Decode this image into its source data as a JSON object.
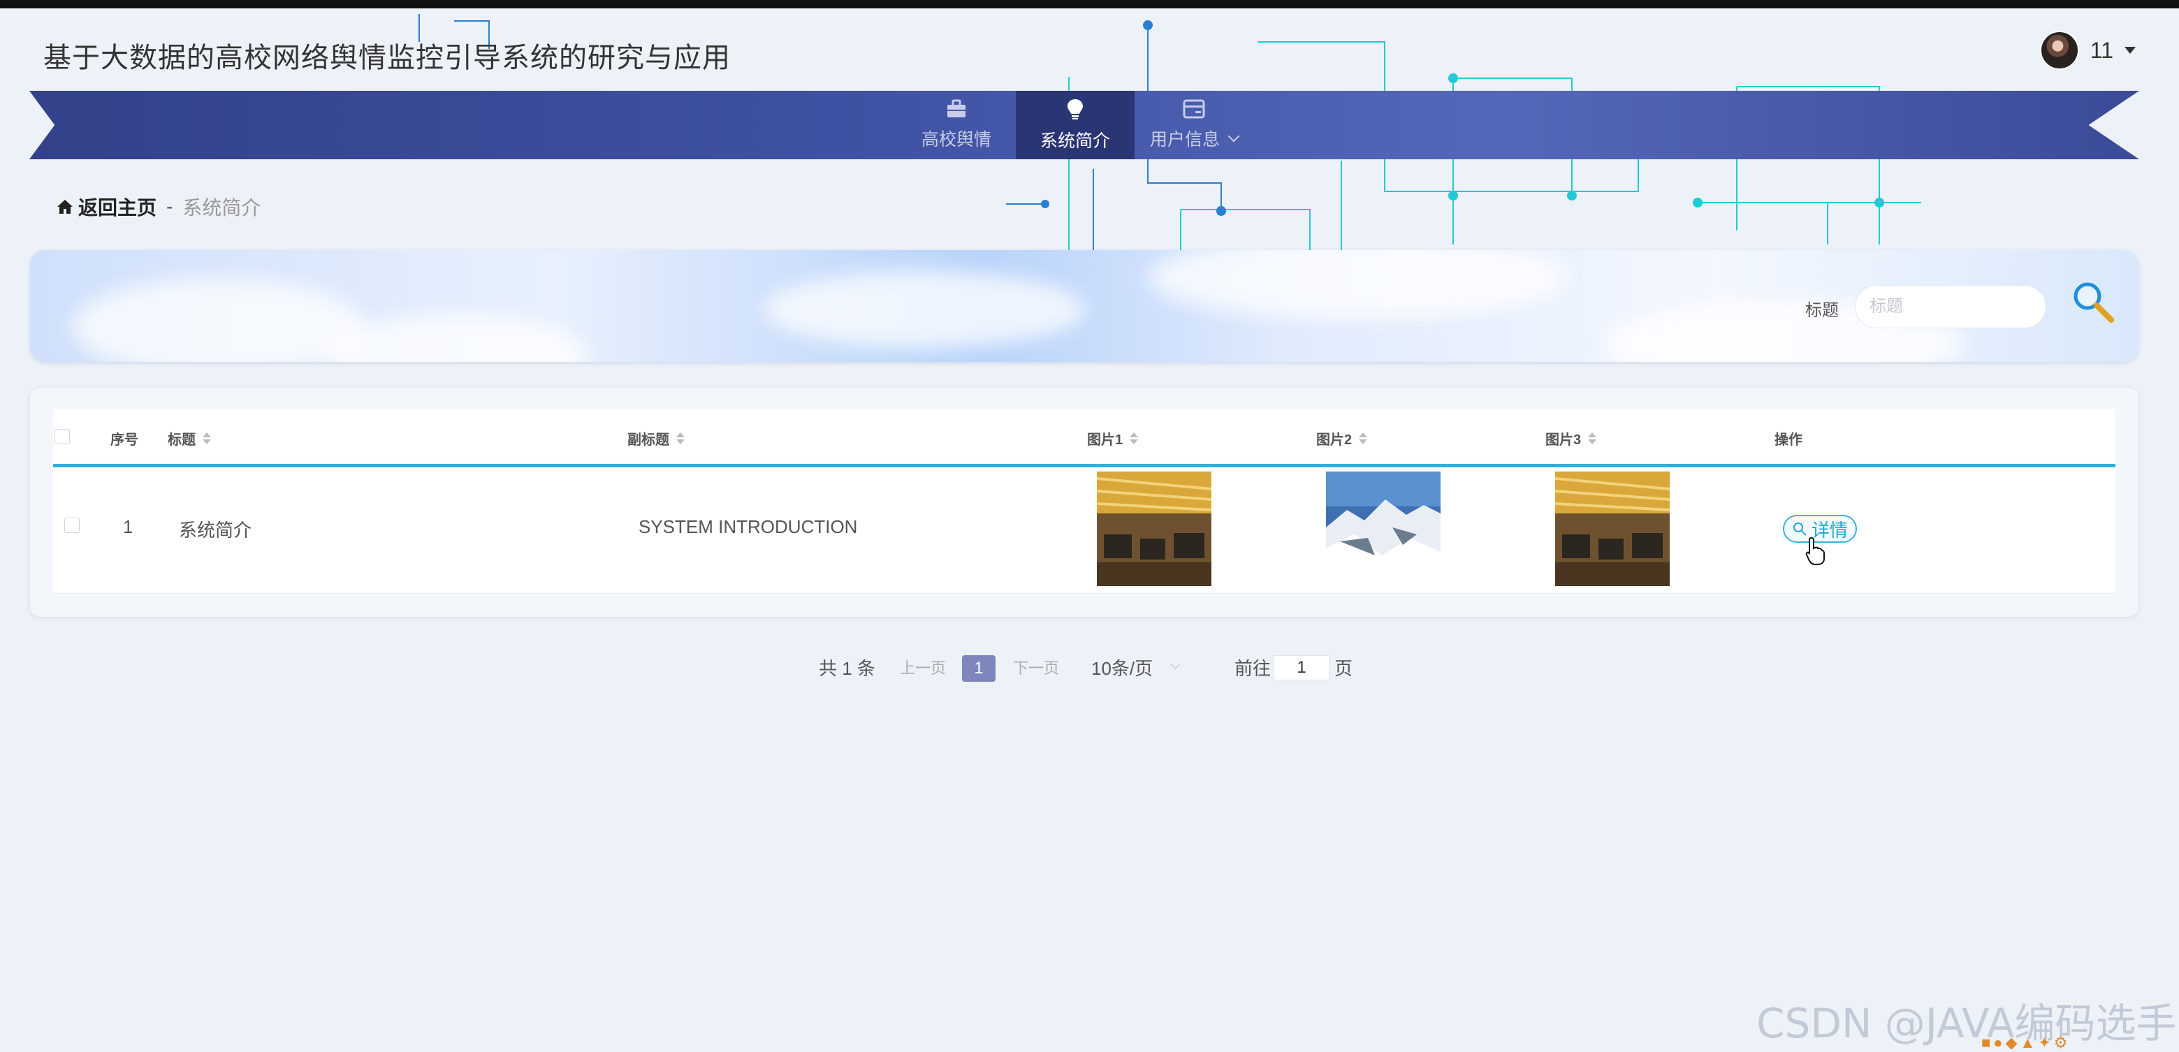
{
  "site_title": "基于大数据的高校网络舆情监控引导系统的研究与应用",
  "user": {
    "name": "11"
  },
  "nav": {
    "items": [
      {
        "label": "高校舆情",
        "icon": "briefcase-icon",
        "active": false
      },
      {
        "label": "系统简介",
        "icon": "lightbulb-icon",
        "active": true
      },
      {
        "label": "用户信息",
        "icon": "card-icon",
        "active": false,
        "has_dropdown": true
      }
    ]
  },
  "breadcrumb": {
    "home": "返回主页",
    "separator": "-",
    "current": "系统简介"
  },
  "search": {
    "label": "标题",
    "placeholder": "标题",
    "value": ""
  },
  "table": {
    "headers": {
      "index": "序号",
      "title": "标题",
      "subtitle": "副标题",
      "image1": "图片1",
      "image2": "图片2",
      "image3": "图片3",
      "actions": "操作"
    },
    "rows": [
      {
        "index": "1",
        "title": "系统简介",
        "subtitle": "SYSTEM INTRODUCTION",
        "image1": "office-interior",
        "image2": "snowy-mountains",
        "image3": "office-interior",
        "action_label": "详情"
      }
    ]
  },
  "pagination": {
    "total": "共 1 条",
    "prev": "上一页",
    "current_page": "1",
    "next": "下一页",
    "page_size": "10条/页",
    "goto_label": "前往",
    "goto_value": "1",
    "page_suffix": "页"
  },
  "watermark": "CSDN @JAVA编码选手",
  "colors": {
    "nav_bg": "#3f52a3",
    "nav_active": "#2a3574",
    "accent_line": "#2fb0dc",
    "pager_active": "#7d86bd"
  }
}
